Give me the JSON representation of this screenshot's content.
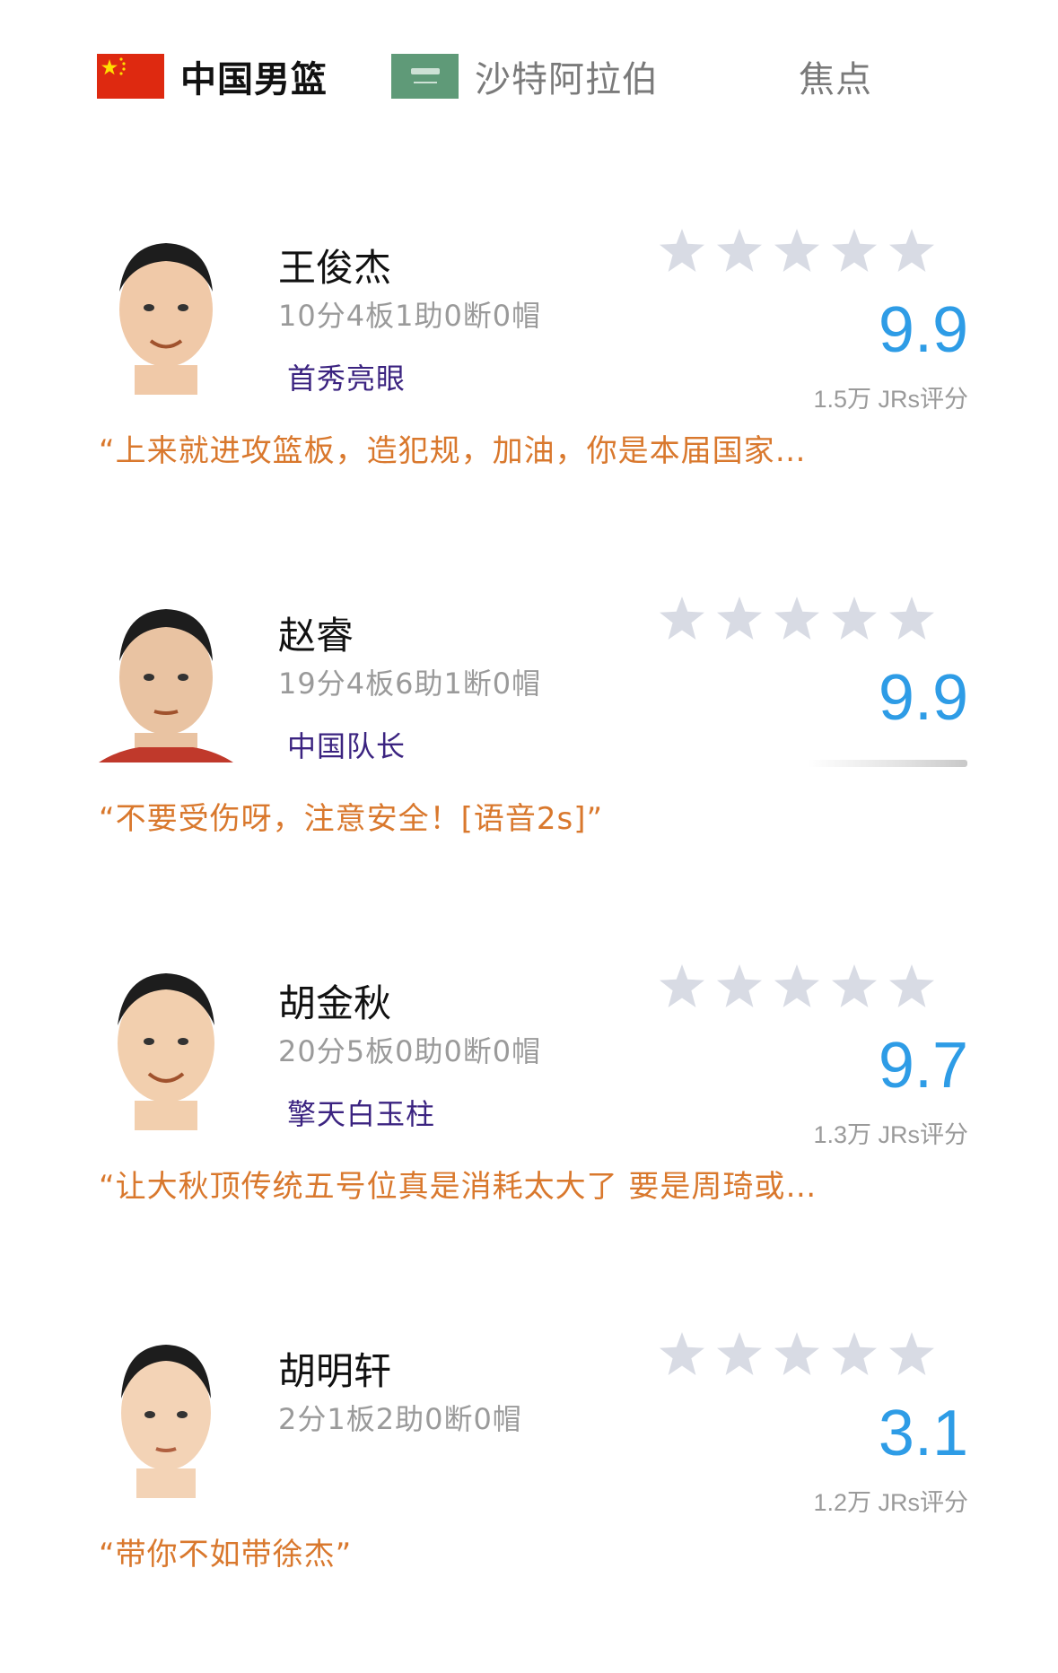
{
  "tabs": [
    {
      "label": "中国男篮",
      "flag": "china-flag-icon",
      "active": true
    },
    {
      "label": "沙特阿拉伯",
      "flag": "saudi-flag-icon",
      "active": false
    },
    {
      "label": "焦点",
      "active": false
    }
  ],
  "colors": {
    "score": "#2e9ce6",
    "comment": "#d9782d",
    "tag": "#3b2380",
    "star_empty": "#d8dbe4"
  },
  "players": [
    {
      "name": "王俊杰",
      "stats": "10分4板1助0断0帽",
      "tag": "首秀亮眼",
      "score": "9.9",
      "rating_count": "1.5万 JRs评分",
      "comment": "“上来就进攻篮板，造犯规，加油，你是本届国家…"
    },
    {
      "name": "赵睿",
      "stats": "19分4板6助1断0帽",
      "tag": "中国队长",
      "score": "9.9",
      "rating_count": "",
      "comment": "“不要受伤呀，注意安全！[语音2s]”"
    },
    {
      "name": "胡金秋",
      "stats": "20分5板0助0断0帽",
      "tag": "擎天白玉柱",
      "score": "9.7",
      "rating_count": "1.3万 JRs评分",
      "comment": "“让大秋顶传统五号位真是消耗太大了 要是周琦或…"
    },
    {
      "name": "胡明轩",
      "stats": "2分1板2助0断0帽",
      "tag": "",
      "score": "3.1",
      "rating_count": "1.2万 JRs评分",
      "comment": "“带你不如带徐杰”"
    }
  ]
}
